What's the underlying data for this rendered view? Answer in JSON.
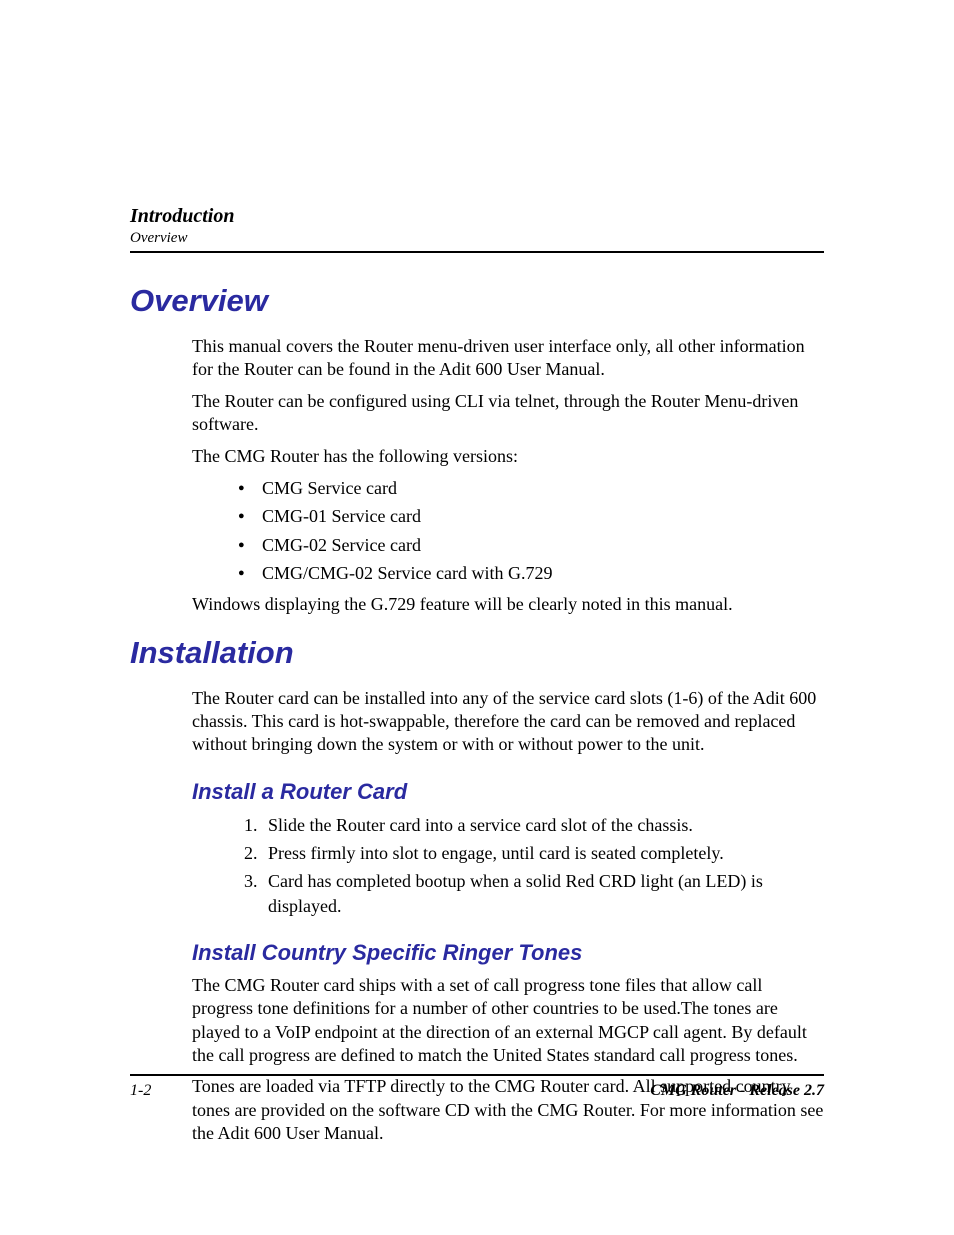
{
  "header": {
    "title": "Introduction",
    "subtitle": "Overview"
  },
  "sections": {
    "overview": {
      "heading": "Overview",
      "p1": "This manual covers the Router menu-driven user interface only, all other information for the Router can be found in the Adit 600 User Manual.",
      "p2": "The Router can be configured using CLI via telnet, through the Router Menu-driven software.",
      "p3": "The CMG Router has the following versions:",
      "bullets": [
        "CMG Service card",
        "CMG-01 Service card",
        "CMG-02 Service card",
        "CMG/CMG-02 Service card with G.729"
      ],
      "p4": "Windows displaying the G.729 feature will be clearly noted in this manual."
    },
    "installation": {
      "heading": "Installation",
      "p1": "The Router card can be installed into any of the service card slots (1-6) of the Adit 600 chassis. This card is hot-swappable, therefore the card can be removed and replaced without bringing down the system or with or without power to the unit.",
      "sub1": {
        "heading": "Install a Router Card",
        "steps": [
          "Slide the Router card into a service card slot of the chassis.",
          "Press firmly into slot to engage, until card is seated completely.",
          "Card has completed bootup when a solid Red CRD light (an LED) is displayed."
        ]
      },
      "sub2": {
        "heading": "Install Country Specific Ringer Tones",
        "p1": "The CMG Router card ships with a set of call progress tone files that allow call progress tone definitions for a number of other countries to be used.The tones are played to a VoIP endpoint at the direction of an external MGCP call agent. By default the call progress are defined to match the United States standard call progress tones.",
        "p2": "Tones are loaded via TFTP directly to the CMG Router card. All supported country tones are provided on the software CD with the CMG Router. For more information see the Adit 600 User Manual."
      }
    }
  },
  "footer": {
    "page": "1-2",
    "product": "CMG Router - Release 2.7"
  }
}
